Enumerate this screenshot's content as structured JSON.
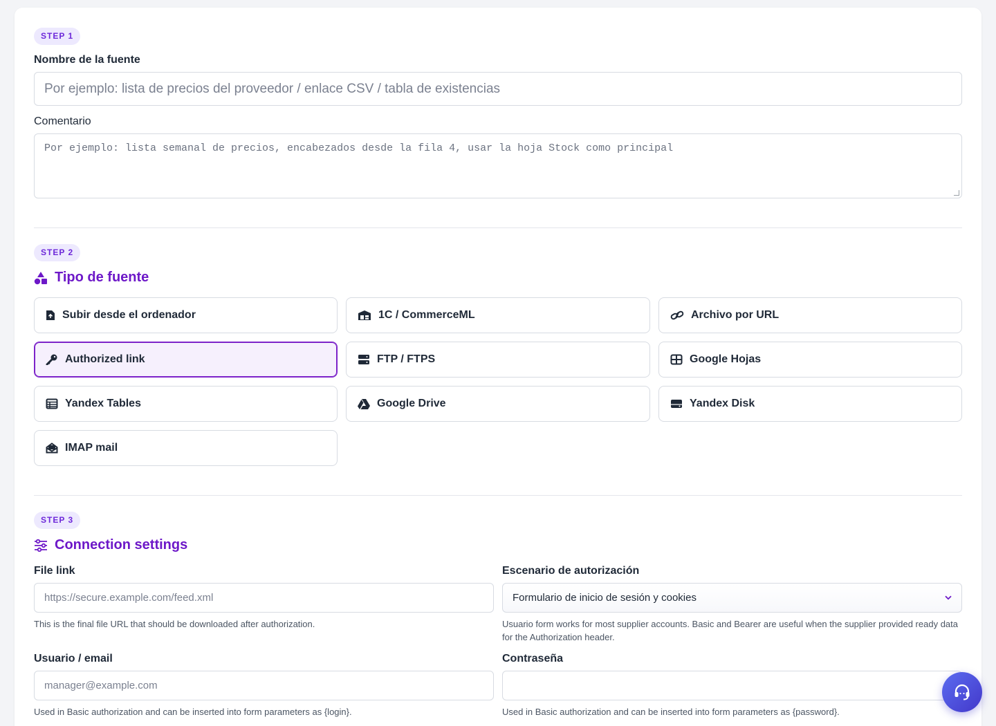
{
  "step1": {
    "badge": "STEP 1",
    "name_label": "Nombre de la fuente",
    "name_placeholder": "Por ejemplo: lista de precios del proveedor / enlace CSV / tabla de existencias",
    "comment_label": "Comentario",
    "comment_placeholder": "Por ejemplo: lista semanal de precios, encabezados desde la fila 4, usar la hoja Stock como principal"
  },
  "step2": {
    "badge": "STEP 2",
    "title": "Tipo de fuente",
    "sources": [
      {
        "label": "Subir desde el ordenador",
        "icon": "file-upload-icon",
        "active": false
      },
      {
        "label": "1C / CommerceML",
        "icon": "warehouse-icon",
        "active": false
      },
      {
        "label": "Archivo por URL",
        "icon": "link-icon",
        "active": false
      },
      {
        "label": "Authorized link",
        "icon": "key-icon",
        "active": true
      },
      {
        "label": "FTP / FTPS",
        "icon": "server-icon",
        "active": false
      },
      {
        "label": "Google Hojas",
        "icon": "table-grid-icon",
        "active": false
      },
      {
        "label": "Yandex Tables",
        "icon": "table-list-icon",
        "active": false
      },
      {
        "label": "Google Drive",
        "icon": "google-drive-icon",
        "active": false
      },
      {
        "label": "Yandex Disk",
        "icon": "hard-drive-icon",
        "active": false
      },
      {
        "label": "IMAP mail",
        "icon": "envelope-open-icon",
        "active": false
      }
    ]
  },
  "step3": {
    "badge": "STEP 3",
    "title": "Connection settings",
    "file_link": {
      "label": "File link",
      "placeholder": "https://secure.example.com/feed.xml",
      "help": "This is the final file URL that should be downloaded after authorization."
    },
    "auth_scenario": {
      "label": "Escenario de autorización",
      "selected": "Formulario de inicio de sesión y cookies",
      "help": "Usuario form works for most supplier accounts. Basic and Bearer are useful when the supplier provided ready data for the Authorization header."
    },
    "user": {
      "label": "Usuario / email",
      "placeholder": "manager@example.com",
      "help": "Used in Basic authorization and can be inserted into form parameters as {login}."
    },
    "password": {
      "label": "Contraseña",
      "value": "",
      "help": "Used in Basic authorization and can be inserted into form parameters as {password}."
    }
  },
  "support": {
    "icon": "headset-icon"
  },
  "colors": {
    "accent": "#6d18c8",
    "badge_bg": "#ede9fe",
    "active_bg": "#f6f0fd",
    "fab": "#4f46e5"
  }
}
